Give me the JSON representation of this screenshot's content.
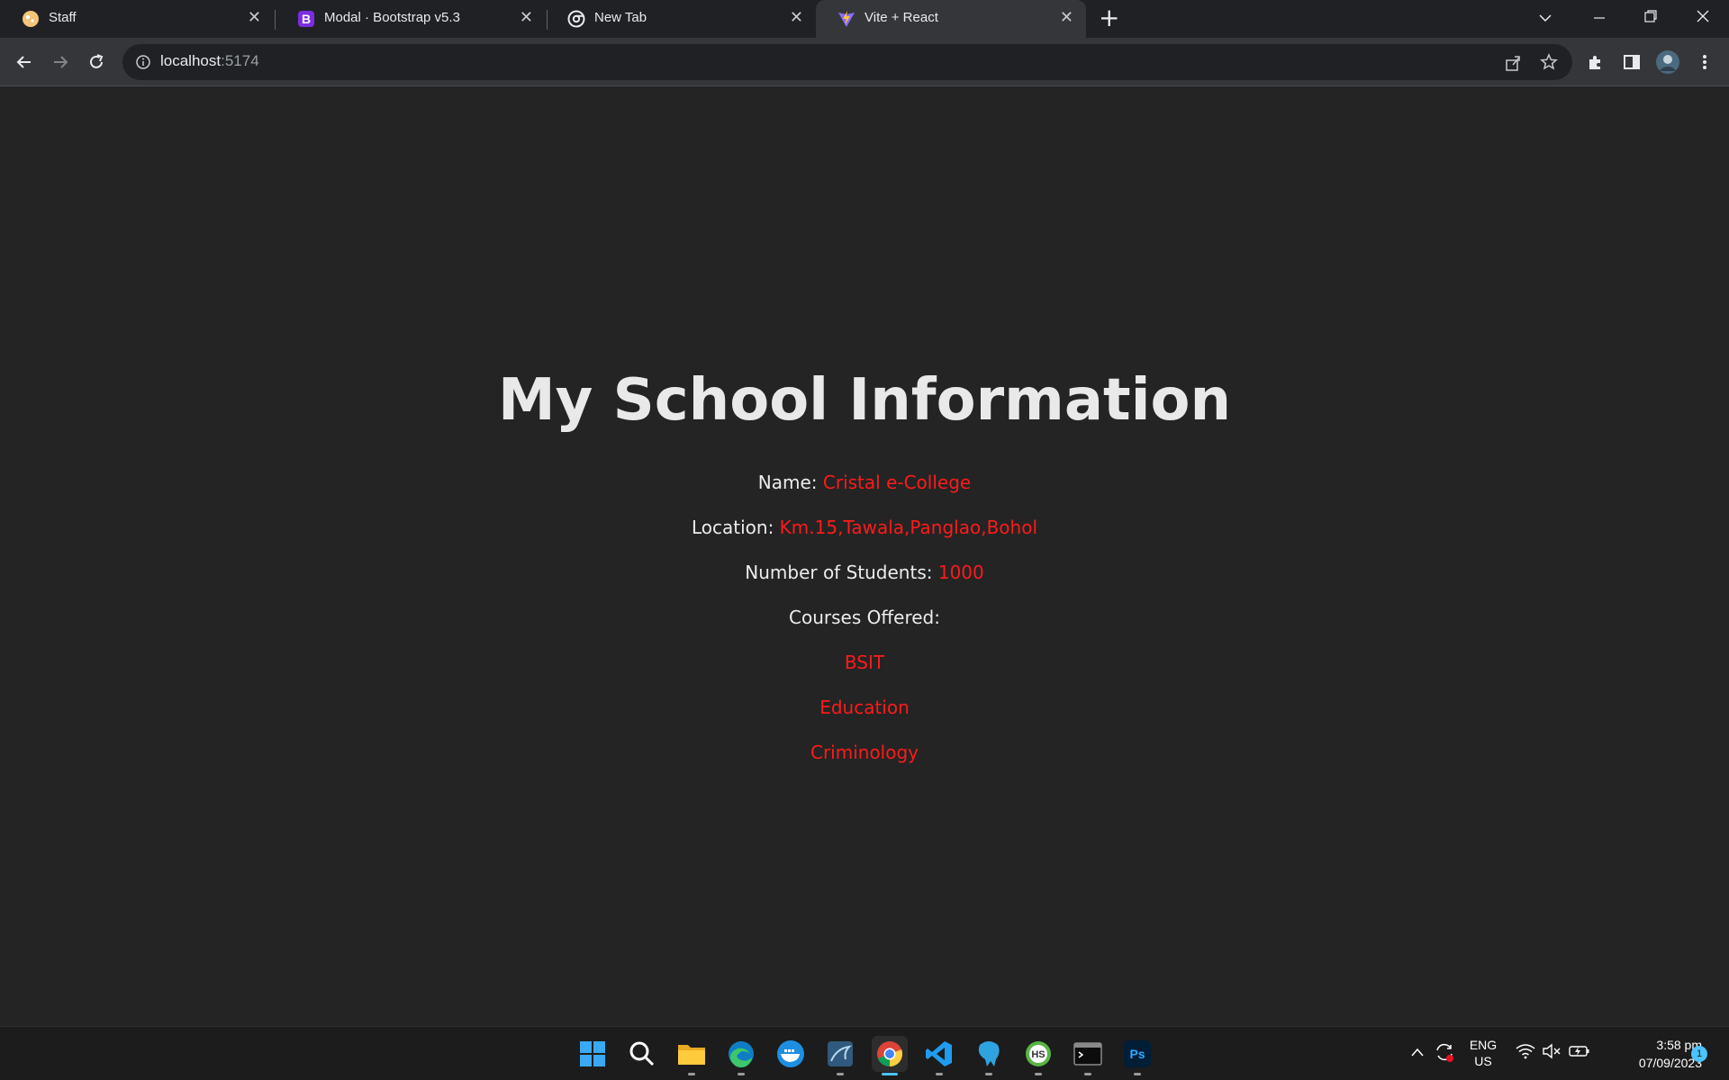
{
  "browser": {
    "tabs": [
      {
        "title": "Staff",
        "icon": "cookie-favicon-icon",
        "active": false
      },
      {
        "title": "Modal · Bootstrap v5.3",
        "icon": "bootstrap-favicon-icon",
        "active": false
      },
      {
        "title": "New Tab",
        "icon": "chrome-favicon-icon",
        "active": false
      },
      {
        "title": "Vite + React",
        "icon": "vite-favicon-icon",
        "active": true
      }
    ],
    "close_glyph": "✕",
    "new_tab_glyph": "+",
    "address": {
      "host": "localhost",
      "port": ":5174"
    }
  },
  "page": {
    "title": "My School Information",
    "name_label": "Name:",
    "name_value": "Cristal e-College",
    "location_label": "Location:",
    "location_value": "Km.15,Tawala,Panglao,Bohol",
    "students_label": "Number of Students:",
    "students_value": "1000",
    "courses_label": "Courses Offered:",
    "courses": [
      "BSIT",
      "Education",
      "Criminology"
    ],
    "accent_color": "#ff1a1a"
  },
  "taskbar": {
    "apps": [
      "windows-start-icon",
      "search-icon",
      "file-explorer-icon",
      "edge-icon",
      "docker-icon",
      "mysql-workbench-icon",
      "chrome-icon",
      "vscode-icon",
      "pgadmin-icon",
      "heidisql-icon",
      "terminal-icon",
      "photoshop-icon"
    ],
    "language": "ENG",
    "region": "US",
    "time": "3:58 pm",
    "date": "07/09/2023",
    "notification_count": "1"
  }
}
